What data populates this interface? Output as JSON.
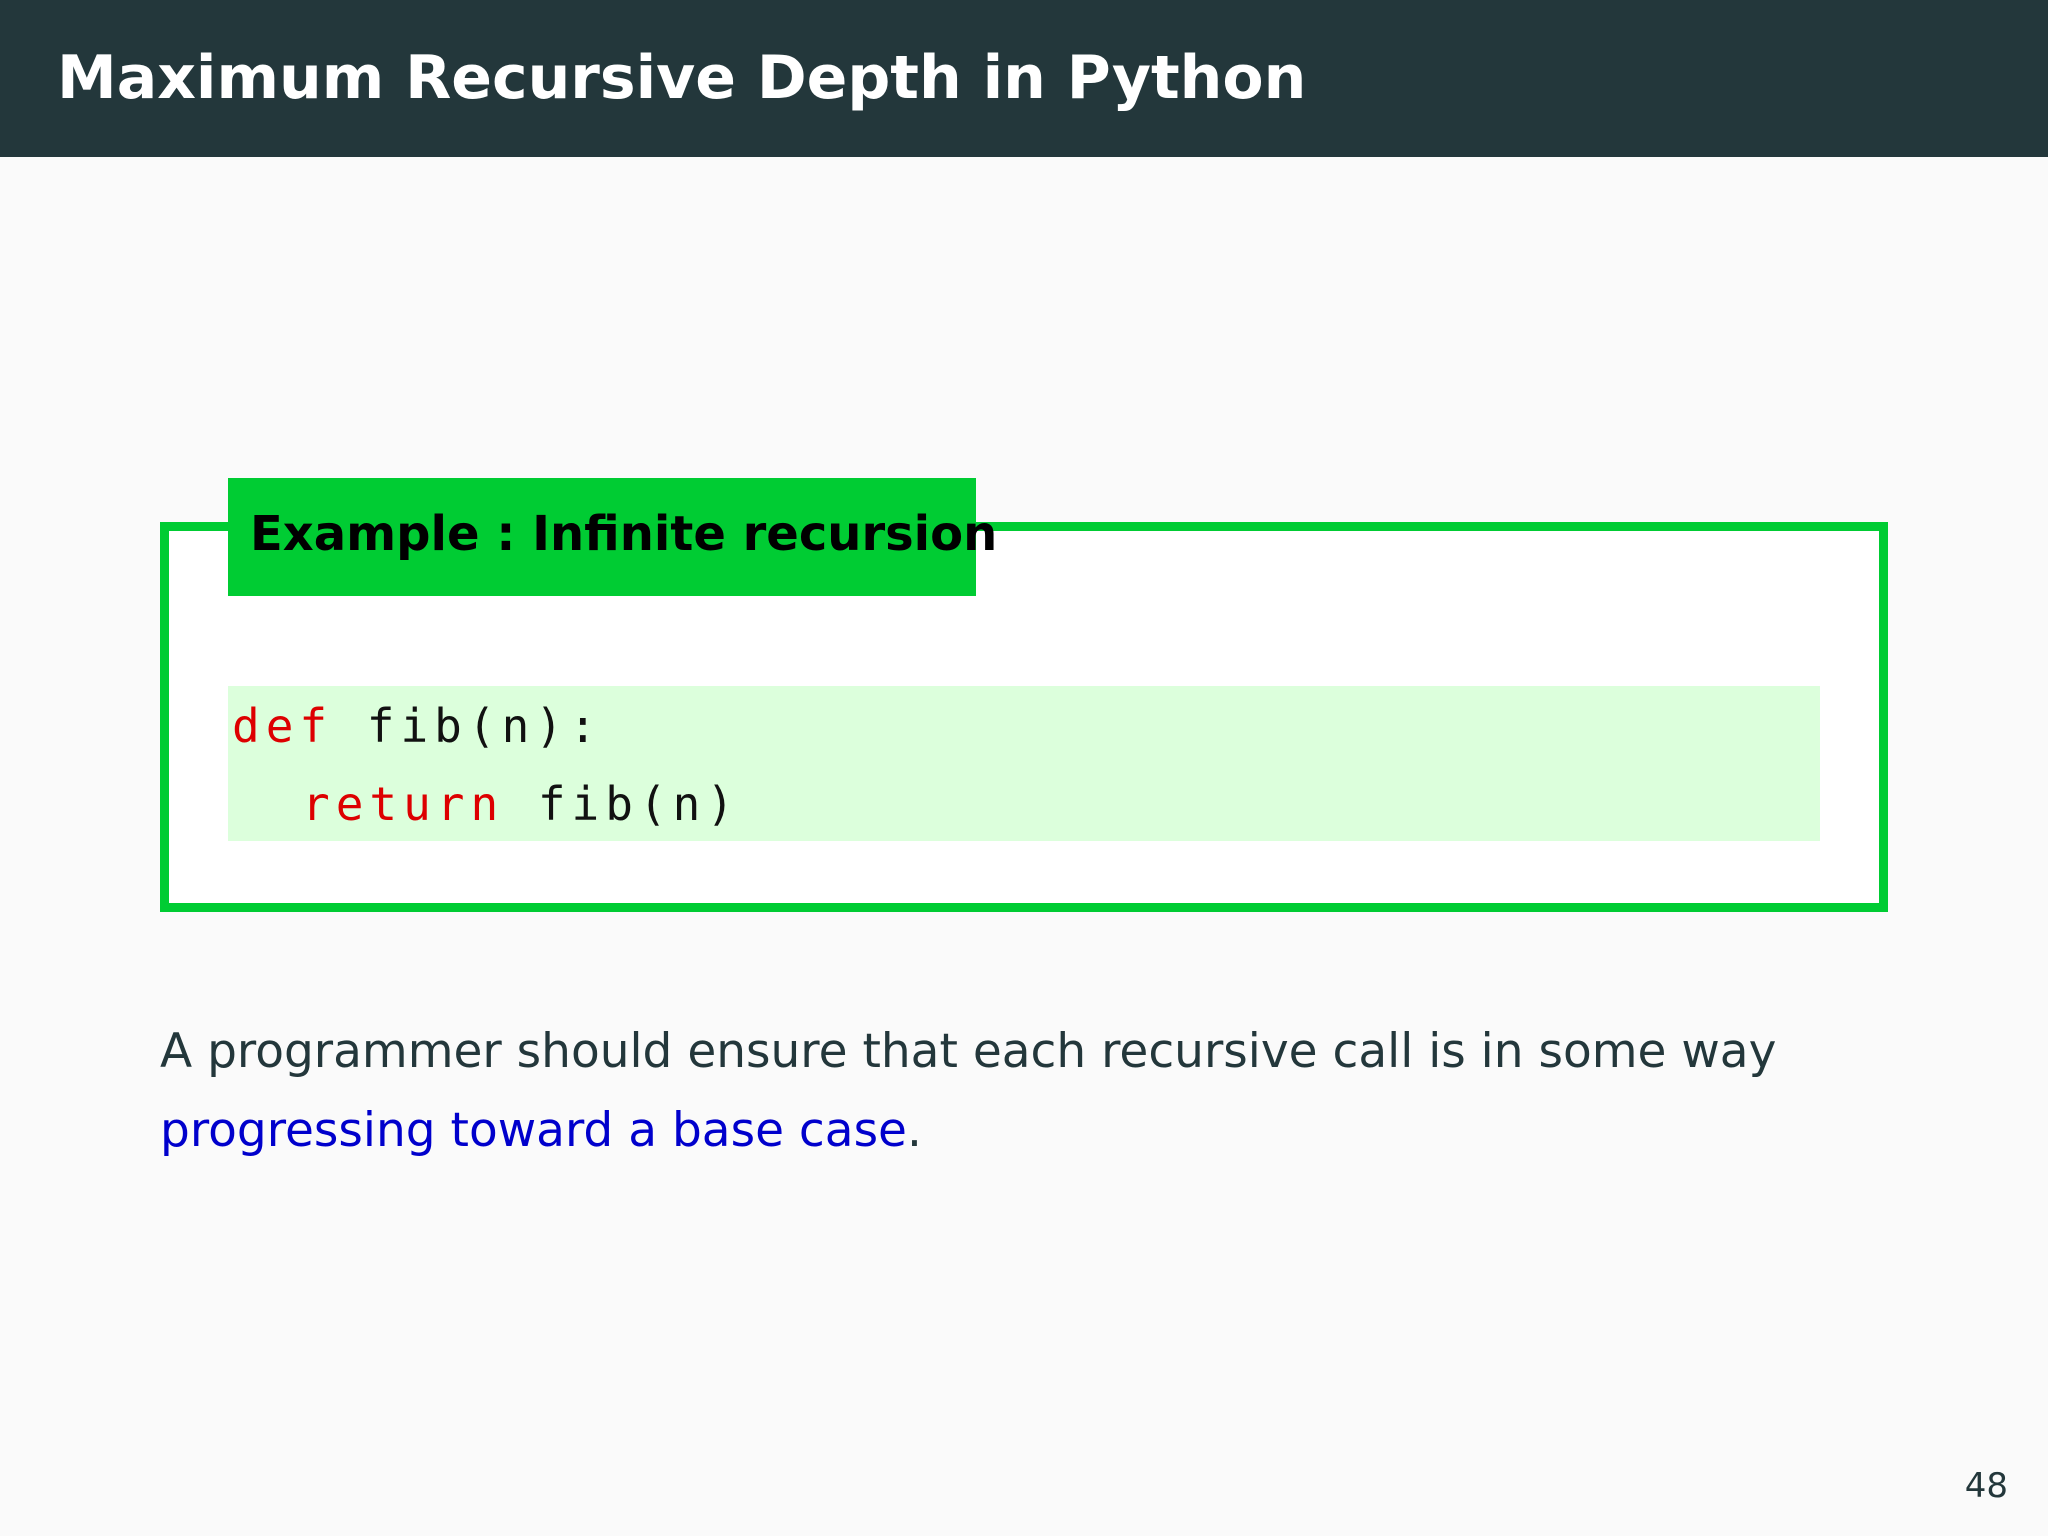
{
  "slide": {
    "title": "Maximum Recursive Depth in Python",
    "page_number": "48"
  },
  "example": {
    "title": "Example : Infinite recursion",
    "code": {
      "line1_keyword": "def",
      "line1_rest": " fib(n):",
      "line2_keyword": "return",
      "line2_rest": " fib(n)"
    }
  },
  "body": {
    "text_plain": "A programmer should ensure that each recursive call is in some way ",
    "text_highlight": "progressing toward a base case",
    "text_end": "."
  },
  "colors": {
    "title_bar": "#23373b",
    "frame_green": "#00cc33",
    "code_background": "#dcffdc",
    "keyword_red": "#dd0000",
    "highlight_blue": "#0000cc"
  }
}
